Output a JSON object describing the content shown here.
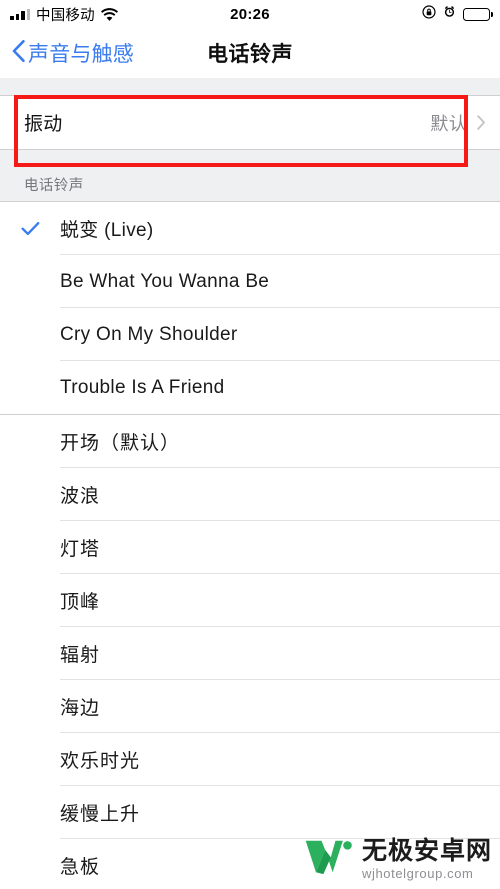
{
  "statusbar": {
    "carrier": "中国移动",
    "time": "20:26",
    "signal_icon": "signal-bars-icon",
    "wifi_icon": "wifi-icon",
    "rotation_lock_icon": "rotation-lock-icon",
    "alarm_icon": "alarm-clock-icon",
    "battery_icon": "battery-icon"
  },
  "navbar": {
    "back_label": "声音与触感",
    "back_icon": "chevron-left-icon",
    "title": "电话铃声"
  },
  "vibration_row": {
    "title": "振动",
    "value": "默认",
    "chevron_icon": "chevron-right-icon"
  },
  "section": {
    "header": "电话铃声"
  },
  "ringtones_custom": [
    {
      "name": "蜕变 (Live)",
      "selected": true
    },
    {
      "name": "Be What You Wanna Be",
      "selected": false
    },
    {
      "name": "Cry On My Shoulder",
      "selected": false
    },
    {
      "name": "Trouble Is A Friend",
      "selected": false
    }
  ],
  "ringtones_system": [
    {
      "name": "开场（默认）",
      "selected": false
    },
    {
      "name": "波浪",
      "selected": false
    },
    {
      "name": "灯塔",
      "selected": false
    },
    {
      "name": "顶峰",
      "selected": false
    },
    {
      "name": "辐射",
      "selected": false
    },
    {
      "name": "海边",
      "selected": false
    },
    {
      "name": "欢乐时光",
      "selected": false
    },
    {
      "name": "缓慢上升",
      "selected": false
    },
    {
      "name": "急板",
      "selected": false
    }
  ],
  "watermark": {
    "brand": "无极安卓网",
    "url": "wjhotelgroup.com",
    "logo_icon": "w-logo-icon"
  },
  "colors": {
    "accent_blue": "#3a7cf0",
    "highlight_red": "#f51a18",
    "group_bg": "#eff0f2",
    "logo_green": "#2bb05e"
  }
}
